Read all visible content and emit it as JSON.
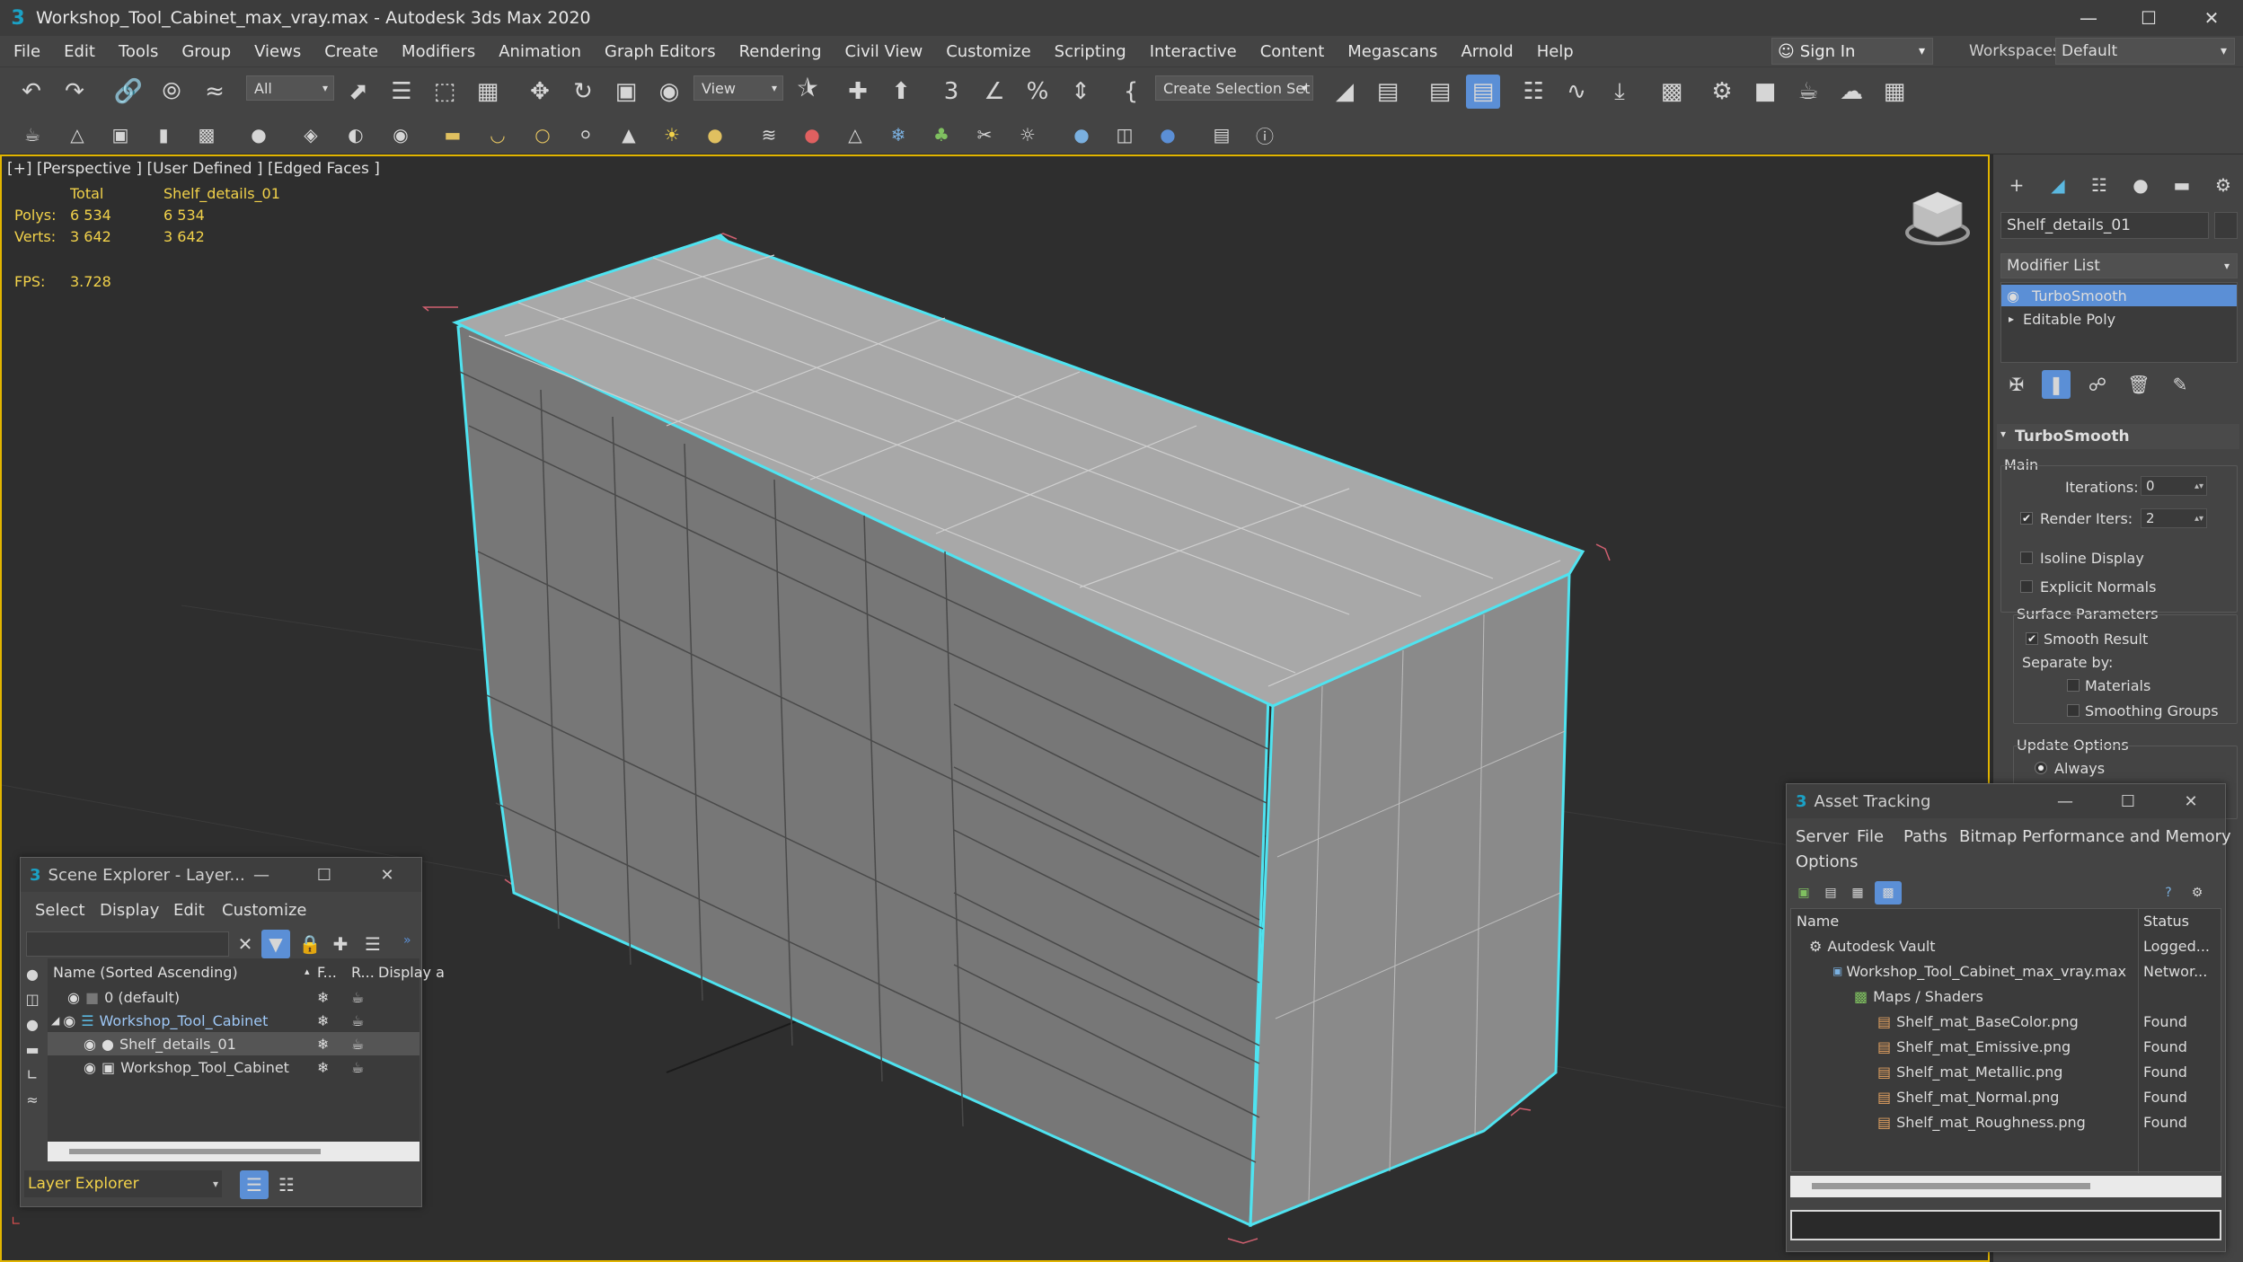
{
  "window": {
    "title": "Workshop_Tool_Cabinet_max_vray.max - Autodesk 3ds Max 2020",
    "logo": "3",
    "min_glyph": "—",
    "max_glyph": "☐",
    "close_glyph": "✕"
  },
  "menu": [
    "File",
    "Edit",
    "Tools",
    "Group",
    "Views",
    "Create",
    "Modifiers",
    "Animation",
    "Graph Editors",
    "Rendering",
    "Civil View",
    "Customize",
    "Scripting",
    "Interactive",
    "Content",
    "Megascans",
    "Arnold",
    "Help"
  ],
  "signin": {
    "label": "Sign In",
    "arrow": "▾",
    "icon": "user-icon"
  },
  "workspaces": {
    "label": "Workspaces:",
    "value": "Default",
    "arrow": "▾"
  },
  "toolbar": {
    "filter_value": "All",
    "refcoord_value": "View",
    "selection_set_value": "Create Selection Set",
    "dropdown_arrow": "▾"
  },
  "viewport": {
    "label": "[+] [Perspective ] [User Defined ] [Edged Faces ]",
    "stats": {
      "col_total": "Total",
      "col_object": "Shelf_details_01",
      "polys_label": "Polys:",
      "polys_total": "6 534",
      "polys_obj": "6 534",
      "verts_label": "Verts:",
      "verts_total": "3 642",
      "verts_obj": "3 642",
      "fps_label": "FPS:",
      "fps_value": "3.728"
    },
    "colors": {
      "selection": "#4fe3f0",
      "wire": "#bfbfbf",
      "active_border": "#e2b500"
    }
  },
  "command_panel": {
    "object_name": "Shelf_details_01",
    "object_color": "#3a3a3a",
    "modifier_list_label": "Modifier List",
    "stack": [
      {
        "name": "TurboSmooth",
        "selected": true,
        "prefix": ""
      },
      {
        "name": "Editable Poly",
        "selected": false,
        "prefix": "▸"
      }
    ],
    "rollout_title": "TurboSmooth",
    "rollout_toggle": "▾",
    "main_label": "Main",
    "iterations_label": "Iterations:",
    "iterations_value": "0",
    "render_iters_label": "Render Iters:",
    "render_iters_value": "2",
    "render_iters_checked": true,
    "isoline_label": "Isoline Display",
    "isoline_checked": false,
    "explicit_normals_label": "Explicit Normals",
    "explicit_normals_checked": false,
    "surface_params_label": "Surface Parameters",
    "smooth_result_label": "Smooth Result",
    "smooth_result_checked": true,
    "separate_by_label": "Separate by:",
    "materials_label": "Materials",
    "materials_checked": false,
    "smoothing_groups_label": "Smoothing Groups",
    "smoothing_groups_checked": false,
    "update_options_label": "Update Options",
    "always_label": "Always",
    "check_glyph": "✔",
    "spin_glyph": "▴▾",
    "selected_color": "#5b8fd6"
  },
  "scene_explorer": {
    "title": "Scene Explorer - Layer...",
    "menu": [
      "Select",
      "Display",
      "Edit",
      "Customize"
    ],
    "col_name": "Name (Sorted Ascending)",
    "col_sort_arrow": "▴",
    "col_f": "F...",
    "col_r": "R...",
    "col_display": "Display a",
    "rows": [
      {
        "name": "0 (default)",
        "indent": 0,
        "expander": "",
        "highlighted": false
      },
      {
        "name": "Workshop_Tool_Cabinet",
        "indent": 0,
        "expander": "◢",
        "highlighted": true
      },
      {
        "name": "Shelf_details_01",
        "indent": 1,
        "expander": "",
        "highlighted": false
      },
      {
        "name": "Workshop_Tool_Cabinet",
        "indent": 1,
        "expander": "",
        "highlighted": false
      }
    ],
    "footer_label": "Layer Explorer",
    "footer_arrow": "▾",
    "clear_glyph": "✕",
    "expand_glyph": "»"
  },
  "asset_tracking": {
    "title": "Asset Tracking",
    "menu": [
      "Server",
      "File",
      "Paths",
      "Bitmap Performance and Memory"
    ],
    "menu2": "Options",
    "col_name": "Name",
    "col_status": "Status",
    "help_glyph": "?",
    "rows": [
      {
        "name": "Autodesk Vault",
        "status": "Logged...",
        "indent": 0,
        "icon": "vault-icon"
      },
      {
        "name": "Workshop_Tool_Cabinet_max_vray.max",
        "status": "Networ...",
        "indent": 1,
        "icon": "max-file-icon"
      },
      {
        "name": "Maps / Shaders",
        "status": "",
        "indent": 2,
        "icon": "maps-icon"
      },
      {
        "name": "Shelf_mat_BaseColor.png",
        "status": "Found",
        "indent": 3,
        "icon": "image-file-icon"
      },
      {
        "name": "Shelf_mat_Emissive.png",
        "status": "Found",
        "indent": 3,
        "icon": "image-file-icon"
      },
      {
        "name": "Shelf_mat_Metallic.png",
        "status": "Found",
        "indent": 3,
        "icon": "image-file-icon"
      },
      {
        "name": "Shelf_mat_Normal.png",
        "status": "Found",
        "indent": 3,
        "icon": "image-file-icon"
      },
      {
        "name": "Shelf_mat_Roughness.png",
        "status": "Found",
        "indent": 3,
        "icon": "image-file-icon"
      }
    ]
  }
}
